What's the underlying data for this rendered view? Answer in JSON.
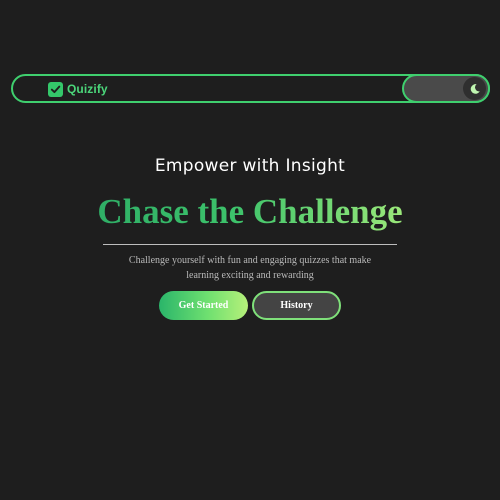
{
  "navbar": {
    "brand_name": "Quizify",
    "brand_icon": "checkbox-icon",
    "toggle_icon": "moon-icon"
  },
  "hero": {
    "subtitle": "Empower with Insight",
    "headline": "Chase the Challenge",
    "description": "Challenge yourself with fun and engaging quizzes that make learning exciting and rewarding"
  },
  "actions": {
    "primary_label": "Get Started",
    "secondary_label": "History"
  },
  "colors": {
    "background": "#1e1e1e",
    "accent": "#3fcf6e",
    "accent_light": "#b6f07a",
    "toggle_bg": "#4a4a4a"
  }
}
